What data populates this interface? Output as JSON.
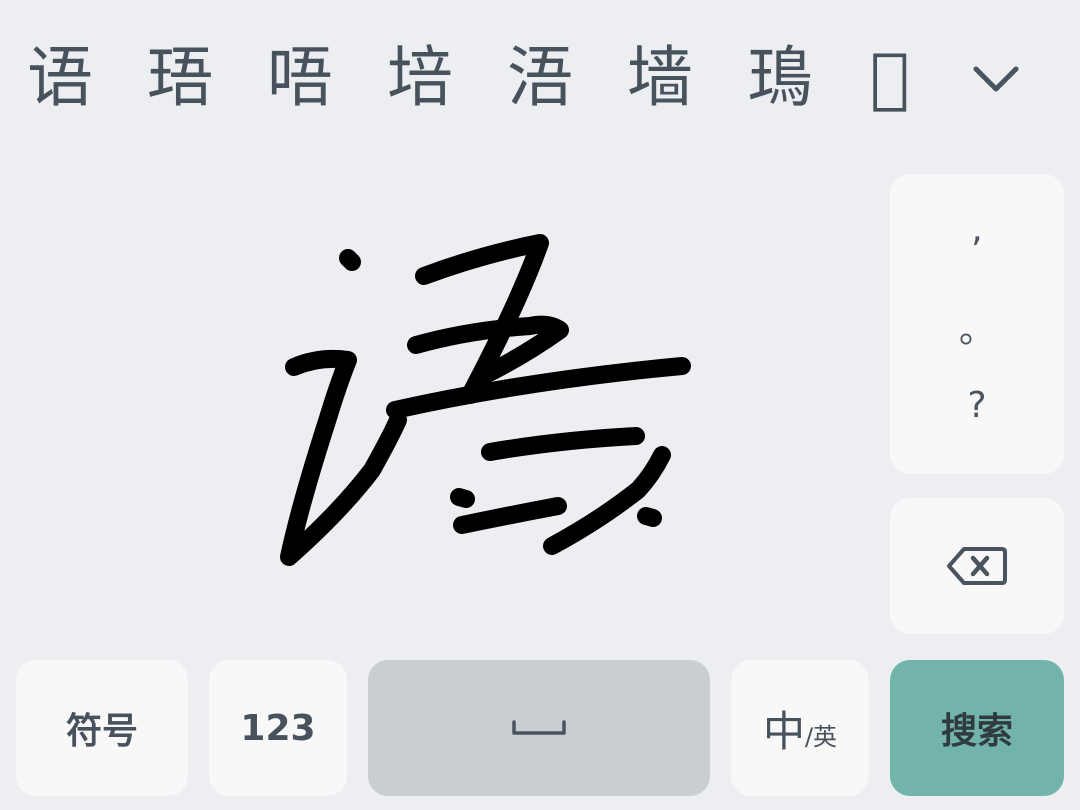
{
  "candidates": [
    "语",
    "珸",
    "唔",
    "培",
    "浯",
    "墙",
    "鳿",
    "𠼫"
  ],
  "icons": {
    "expand": "chevron-down-icon",
    "backspace": "backspace-icon",
    "space": "space-bar-icon"
  },
  "punctuation": [
    ",",
    "。",
    "?"
  ],
  "keys": {
    "symbols": "符号",
    "numbers": "123",
    "lang_main": "中",
    "lang_sub": "/英",
    "search": "搜索"
  },
  "colors": {
    "background": "#eceef1",
    "key": "#f8f8f9",
    "space_key": "#c9ced2",
    "search_key": "#73b4aa",
    "ink": "#000000"
  }
}
